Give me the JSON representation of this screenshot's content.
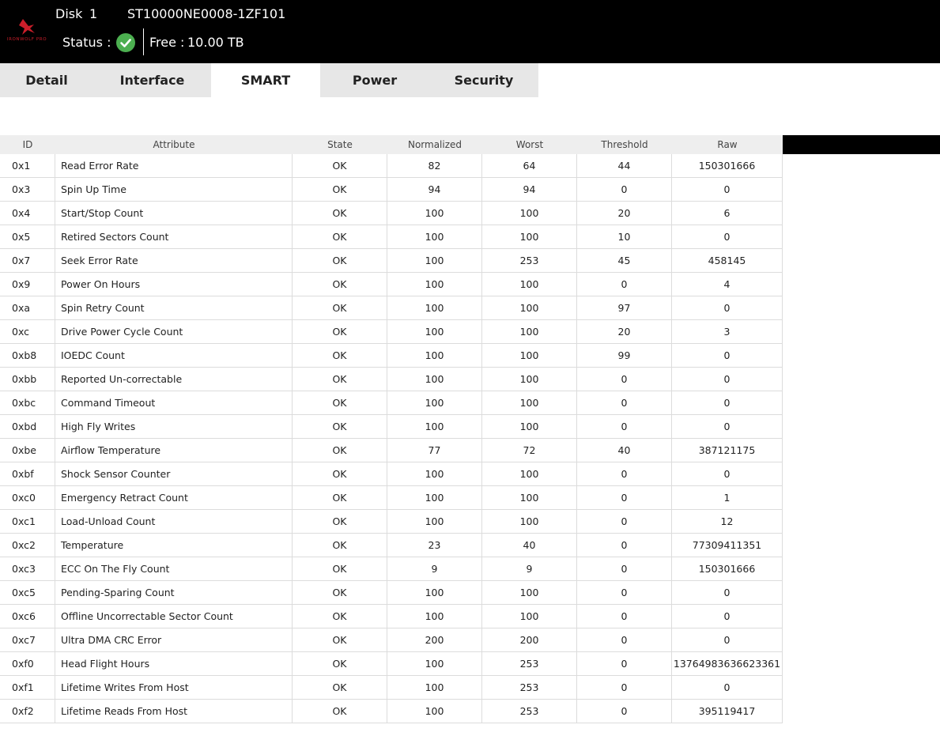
{
  "header": {
    "brand": "IRONWOLF PRO",
    "disk_label": "Disk",
    "disk_number": "1",
    "model": "ST10000NE0008-1ZF101",
    "status_label": "Status :",
    "status_icon": "check-circle-icon",
    "status_color": "#4caf50",
    "free_label": "Free :",
    "free_value": "10.00 TB"
  },
  "tabs": [
    {
      "label": "Detail",
      "active": false
    },
    {
      "label": "Interface",
      "active": false
    },
    {
      "label": "SMART",
      "active": true
    },
    {
      "label": "Power",
      "active": false
    },
    {
      "label": "Security",
      "active": false
    }
  ],
  "table": {
    "columns": [
      "ID",
      "Attribute",
      "State",
      "Normalized",
      "Worst",
      "Threshold",
      "Raw"
    ],
    "rows": [
      [
        "0x1",
        "Read Error Rate",
        "OK",
        "82",
        "64",
        "44",
        "150301666"
      ],
      [
        "0x3",
        "Spin Up Time",
        "OK",
        "94",
        "94",
        "0",
        "0"
      ],
      [
        "0x4",
        "Start/Stop Count",
        "OK",
        "100",
        "100",
        "20",
        "6"
      ],
      [
        "0x5",
        "Retired Sectors Count",
        "OK",
        "100",
        "100",
        "10",
        "0"
      ],
      [
        "0x7",
        "Seek Error Rate",
        "OK",
        "100",
        "253",
        "45",
        "458145"
      ],
      [
        "0x9",
        "Power On Hours",
        "OK",
        "100",
        "100",
        "0",
        "4"
      ],
      [
        "0xa",
        "Spin Retry Count",
        "OK",
        "100",
        "100",
        "97",
        "0"
      ],
      [
        "0xc",
        "Drive Power Cycle Count",
        "OK",
        "100",
        "100",
        "20",
        "3"
      ],
      [
        "0xb8",
        "IOEDC Count",
        "OK",
        "100",
        "100",
        "99",
        "0"
      ],
      [
        "0xbb",
        "Reported Un-correctable",
        "OK",
        "100",
        "100",
        "0",
        "0"
      ],
      [
        "0xbc",
        "Command Timeout",
        "OK",
        "100",
        "100",
        "0",
        "0"
      ],
      [
        "0xbd",
        "High Fly Writes",
        "OK",
        "100",
        "100",
        "0",
        "0"
      ],
      [
        "0xbe",
        "Airflow Temperature",
        "OK",
        "77",
        "72",
        "40",
        "387121175"
      ],
      [
        "0xbf",
        "Shock Sensor Counter",
        "OK",
        "100",
        "100",
        "0",
        "0"
      ],
      [
        "0xc0",
        "Emergency Retract Count",
        "OK",
        "100",
        "100",
        "0",
        "1"
      ],
      [
        "0xc1",
        "Load-Unload Count",
        "OK",
        "100",
        "100",
        "0",
        "12"
      ],
      [
        "0xc2",
        "Temperature",
        "OK",
        "23",
        "40",
        "0",
        "77309411351"
      ],
      [
        "0xc3",
        "ECC On The Fly Count",
        "OK",
        "9",
        "9",
        "0",
        "150301666"
      ],
      [
        "0xc5",
        "Pending-Sparing Count",
        "OK",
        "100",
        "100",
        "0",
        "0"
      ],
      [
        "0xc6",
        "Offline Uncorrectable Sector Count",
        "OK",
        "100",
        "100",
        "0",
        "0"
      ],
      [
        "0xc7",
        "Ultra DMA CRC Error",
        "OK",
        "200",
        "200",
        "0",
        "0"
      ],
      [
        "0xf0",
        "Head Flight Hours",
        "OK",
        "100",
        "253",
        "0",
        "13764983636623361"
      ],
      [
        "0xf1",
        "Lifetime Writes From Host",
        "OK",
        "100",
        "253",
        "0",
        "0"
      ],
      [
        "0xf2",
        "Lifetime Reads From Host",
        "OK",
        "100",
        "253",
        "0",
        "395119417"
      ]
    ]
  }
}
